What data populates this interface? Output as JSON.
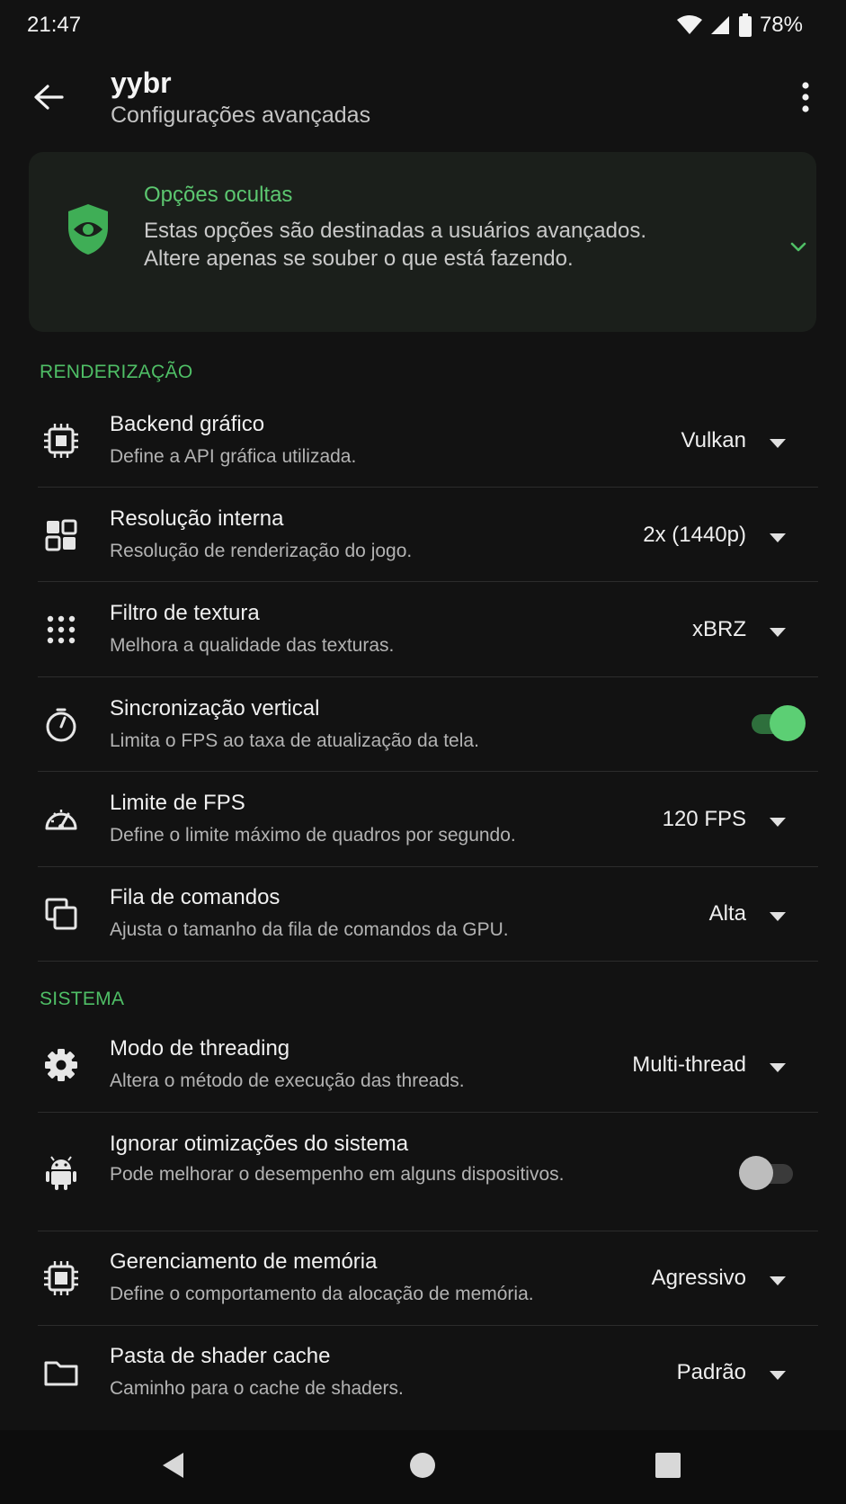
{
  "status_bar": {
    "time": "21:47",
    "battery_percent": "78%",
    "icons": [
      "wifi-icon",
      "signal-icon",
      "battery-icon"
    ]
  },
  "app_bar": {
    "title": "yybr",
    "subtitle": "Configurações avançadas",
    "back_icon": "arrow-back-icon",
    "menu_icon": "more-vert-icon"
  },
  "info_card": {
    "title": "Opções ocultas",
    "text": "Estas opções são destinadas a usuários avançados. Altere apenas se souber o que está fazendo.",
    "icon": "shield-eye-icon",
    "expand_icon": "chevron-down-icon"
  },
  "sections": [
    {
      "header": "RENDERIZAÇÃO",
      "items": [
        {
          "icon": "chip-icon",
          "title": "Backend gráfico",
          "desc": "Define a API gráfica utilizada.",
          "value": "Vulkan",
          "type": "dropdown"
        },
        {
          "icon": "grid-icon",
          "title": "Resolução interna",
          "desc": "Resolução de renderização do jogo.",
          "value": "2x (1440p)",
          "type": "dropdown"
        },
        {
          "icon": "dots-grid-icon",
          "title": "Filtro de textura",
          "desc": "Melhora a qualidade das texturas.",
          "value": "xBRZ",
          "type": "dropdown"
        },
        {
          "icon": "timer-icon",
          "title": "Sincronização vertical",
          "desc": "Limita o FPS ao taxa de atualização da tela.",
          "value": "on",
          "type": "toggle"
        },
        {
          "icon": "speedometer-icon",
          "title": "Limite de FPS",
          "desc": "Define o limite máximo de quadros por segundo.",
          "value": "120 FPS",
          "type": "dropdown"
        },
        {
          "icon": "copy-icon",
          "title": "Fila de comandos",
          "desc": "Ajusta o tamanho da fila de comandos da GPU.",
          "value": "Alta",
          "type": "dropdown"
        }
      ]
    },
    {
      "header": "SISTEMA",
      "items": [
        {
          "icon": "gear-icon",
          "title": "Modo de threading",
          "desc": "Altera o método de execução das threads.",
          "value": "Multi-thread",
          "type": "dropdown"
        },
        {
          "icon": "android-icon",
          "title": "Ignorar otimizações do sistema",
          "desc": "Pode melhorar o desempenho em alguns dispositivos.",
          "value": "off",
          "type": "toggle"
        },
        {
          "icon": "memory-icon",
          "title": "Gerenciamento de memória",
          "desc": "Define o comportamento da alocação de memória.",
          "value": "Agressivo",
          "type": "dropdown"
        },
        {
          "icon": "folder-icon",
          "title": "Pasta de shader cache",
          "desc": "Caminho para o cache de shaders.",
          "value": "Padrão",
          "type": "dropdown"
        }
      ]
    }
  ],
  "nav_bar": {
    "icons": [
      "nav-back-icon",
      "nav-home-icon",
      "nav-recents-icon"
    ]
  },
  "colors": {
    "background": "#121212",
    "accent": "#5cc770",
    "card": "#1b1f1b"
  }
}
